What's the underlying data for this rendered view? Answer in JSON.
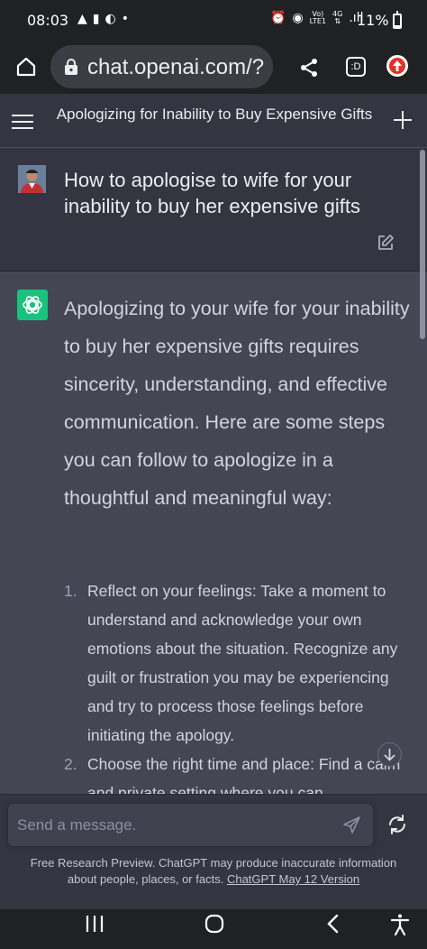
{
  "status_bar": {
    "time": "08:03",
    "left_icons": [
      "alert-icon",
      "sim-icon",
      "dnd-icon",
      "dot-icon"
    ],
    "right_icons": [
      "alarm-icon",
      "location-icon",
      "volte-icon",
      "signal-4g-icon",
      "signal-icon"
    ],
    "network_label_top": "Vo)",
    "network_label_bottom": "LTE1",
    "network_type": "4G",
    "battery": "11%"
  },
  "browser": {
    "url": "chat.openai.com/?",
    "tab_count": ":D",
    "icons": [
      "home-icon",
      "lock-icon",
      "share-icon",
      "tab-switcher-icon",
      "upload-icon"
    ]
  },
  "header": {
    "title": "Apologizing for Inability to Buy Expensive Gifts",
    "icons": [
      "menu-icon",
      "new-chat-icon"
    ]
  },
  "user_message": {
    "text": "How to apologise to wife for your inability to buy her expensive gifts",
    "icons": [
      "avatar",
      "edit-icon"
    ]
  },
  "assistant_message": {
    "intro": "Apologizing to your wife for your inability to buy her expensive gifts requires sincerity, understanding, and effective communication. Here are some steps you can follow to apologize in a thoughtful and meaningful way:",
    "steps": [
      {
        "num": "1.",
        "text": "Reflect on your feelings: Take a moment to understand and acknowledge your own emotions about the situation. Recognize any guilt or frustration you may be experiencing and try to process those feelings before initiating the apology."
      },
      {
        "num": "2.",
        "text": "Choose the right time and place: Find a calm and private setting where you can"
      }
    ],
    "icons": [
      "chatgpt-logo-icon",
      "scroll-down-icon"
    ]
  },
  "composer": {
    "placeholder": "Send a message.",
    "footer_text": "Free Research Preview. ChatGPT may produce inaccurate information about people, places, or facts.",
    "footer_link": "ChatGPT May 12 Version",
    "icons": [
      "send-icon",
      "regenerate-icon"
    ]
  },
  "nav_bar": {
    "icons": [
      "recent-apps-icon",
      "home-button-icon",
      "back-icon",
      "accessibility-icon"
    ]
  },
  "colors": {
    "background": "#343541",
    "assistant_bg": "#444654",
    "chrome_bg": "#202123",
    "accent": "#19c37d",
    "upload_badge": "#e0302a"
  }
}
